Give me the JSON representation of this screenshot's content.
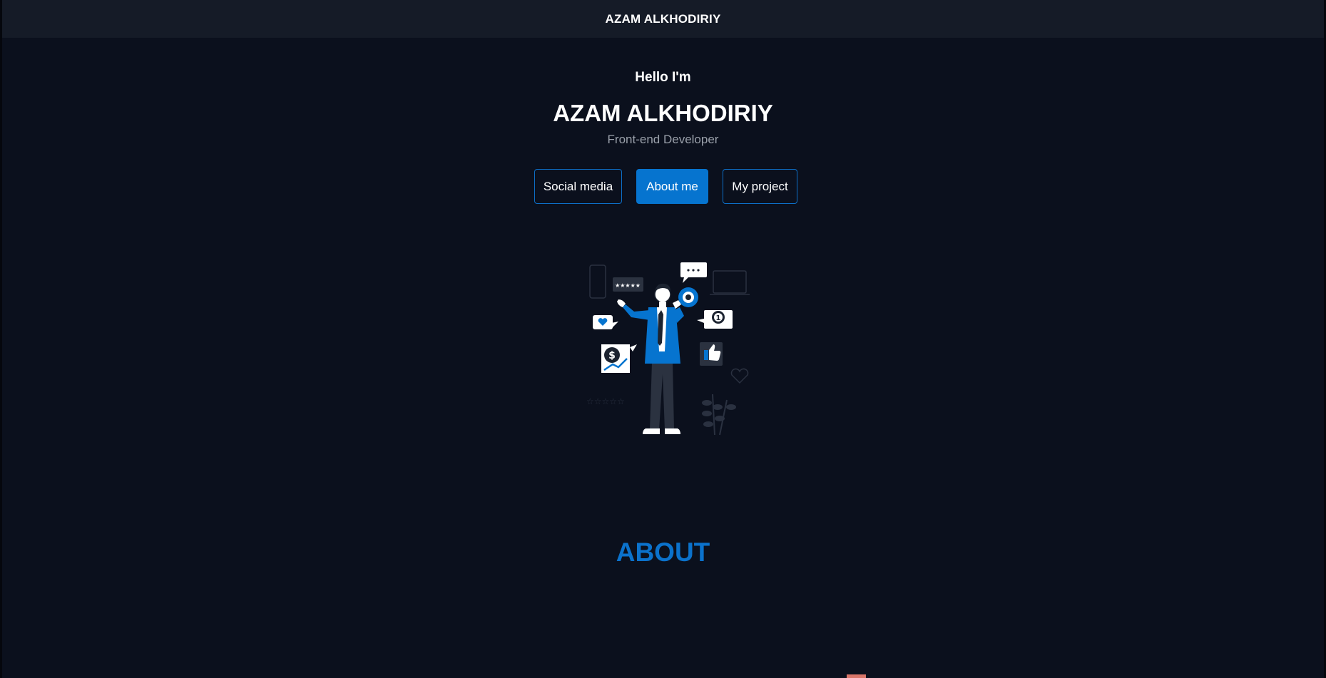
{
  "header": {
    "brand": "AZAM ALKHODIRIY"
  },
  "hero": {
    "greeting": "Hello I'm",
    "name": "AZAM ALKHODIRIY",
    "role": "Front-end Developer",
    "buttons": [
      {
        "label": "Social media",
        "active": false
      },
      {
        "label": "About me",
        "active": true
      },
      {
        "label": "My project",
        "active": false
      }
    ],
    "illustration": {
      "icon": "marketing-man-megaphone-illustration"
    }
  },
  "about": {
    "title": "ABOUT"
  },
  "colors": {
    "background": "#0b101d",
    "topbar": "#151b27",
    "accent": "#0674cf",
    "muted_text": "#9aa0aa"
  }
}
